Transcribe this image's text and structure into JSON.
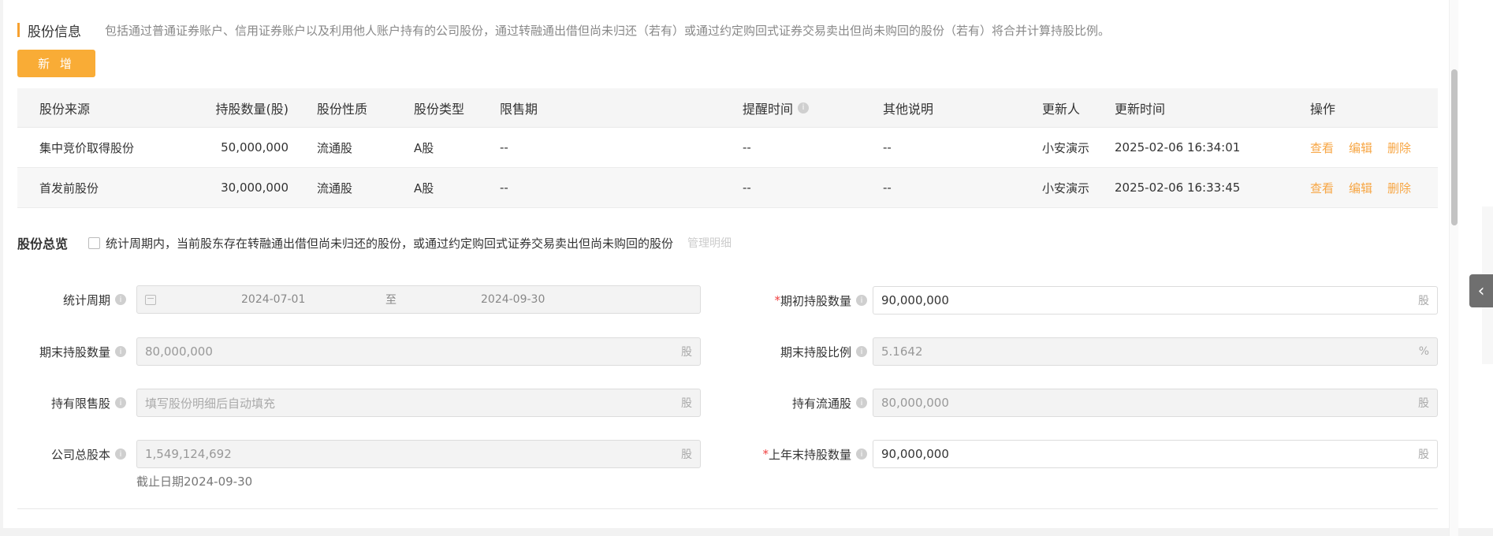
{
  "header": {
    "title": "股份信息",
    "note": "包括通过普通证券账户、信用证券账户以及利用他人账户持有的公司股份，通过转融通出借但尚未归还（若有）或通过约定购回式证券交易卖出但尚未购回的股份（若有）将合并计算持股比例。",
    "add_label": "新 增"
  },
  "table": {
    "columns": [
      "股份来源",
      "持股数量(股)",
      "股份性质",
      "股份类型",
      "限售期",
      "提醒时间",
      "其他说明",
      "更新人",
      "更新时间",
      "操作"
    ],
    "rows": [
      {
        "source": "集中竞价取得股份",
        "qty": "50,000,000",
        "nature": "流通股",
        "type": "A股",
        "lockup": "--",
        "remind": "--",
        "other": "--",
        "updater": "小安演示",
        "time": "2025-02-06 16:34:01"
      },
      {
        "source": "首发前股份",
        "qty": "30,000,000",
        "nature": "流通股",
        "type": "A股",
        "lockup": "--",
        "remind": "--",
        "other": "--",
        "updater": "小安演示",
        "time": "2025-02-06 16:33:45"
      }
    ],
    "ops": {
      "view": "查看",
      "edit": "编辑",
      "delete": "删除"
    }
  },
  "overview": {
    "title": "股份总览",
    "checkbox_label": "统计周期内，当前股东存在转融通出借但尚未归还的股份，或通过约定购回式证券交易卖出但尚未购回的股份",
    "manage_link": "管理明细"
  },
  "form": {
    "period": {
      "label": "统计周期",
      "start": "2024-07-01",
      "sep": "至",
      "end": "2024-09-30"
    },
    "initial_holding": {
      "required": "*",
      "label": "期初持股数量",
      "value": "90,000,000",
      "unit": "股"
    },
    "end_holding": {
      "label": "期末持股数量",
      "value": "80,000,000",
      "unit": "股"
    },
    "end_ratio": {
      "label": "期末持股比例",
      "value": "5.1642",
      "unit": "%"
    },
    "restricted": {
      "label": "持有限售股",
      "placeholder": "填写股份明细后自动填充",
      "unit": "股"
    },
    "tradable": {
      "label": "持有流通股",
      "value": "80,000,000",
      "unit": "股"
    },
    "total_capital": {
      "label": "公司总股本",
      "value": "1,549,124,692",
      "unit": "股",
      "cutoff": "截止日期2024-09-30"
    },
    "last_year_end": {
      "required": "*",
      "label": "上年末持股数量",
      "value": "90,000,000",
      "unit": "股"
    }
  },
  "side": {
    "toggle_icon": "‹"
  },
  "colors": {
    "accent": "#f9ac36",
    "link": "#f7a644",
    "required": "#f04040"
  }
}
